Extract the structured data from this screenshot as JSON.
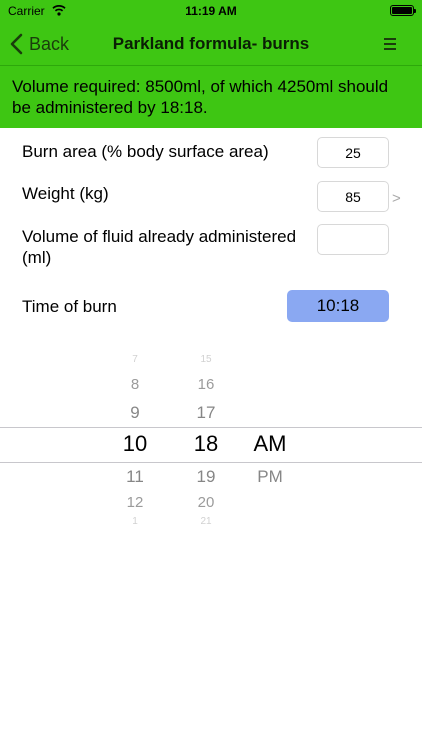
{
  "status_bar": {
    "carrier": "Carrier",
    "time": "11:19 AM"
  },
  "nav": {
    "back_label": "Back",
    "title": "Parkland formula- burns"
  },
  "result": {
    "text": "Volume required: 8500ml, of which 4250ml should be administered by 18:18."
  },
  "form": {
    "burn_area": {
      "label": "Burn area (% body surface area)",
      "value": "25"
    },
    "weight": {
      "label": "Weight (kg)",
      "value": "85",
      "disclosure": ">"
    },
    "fluid_given": {
      "label": "Volume of fluid already administered (ml)",
      "value": ""
    },
    "time_of_burn": {
      "label": "Time of burn",
      "value": "10:18"
    }
  },
  "picker": {
    "hours": [
      "7",
      "8",
      "9",
      "10",
      "11",
      "12",
      "1"
    ],
    "minutes": [
      "15",
      "16",
      "17",
      "18",
      "19",
      "20",
      "21"
    ],
    "periods": [
      "AM",
      "PM"
    ],
    "selected_hour": "10",
    "selected_minute": "18",
    "selected_period": "AM"
  },
  "colors": {
    "accent_green": "#3ec613",
    "time_button": "#8aa8f2"
  }
}
